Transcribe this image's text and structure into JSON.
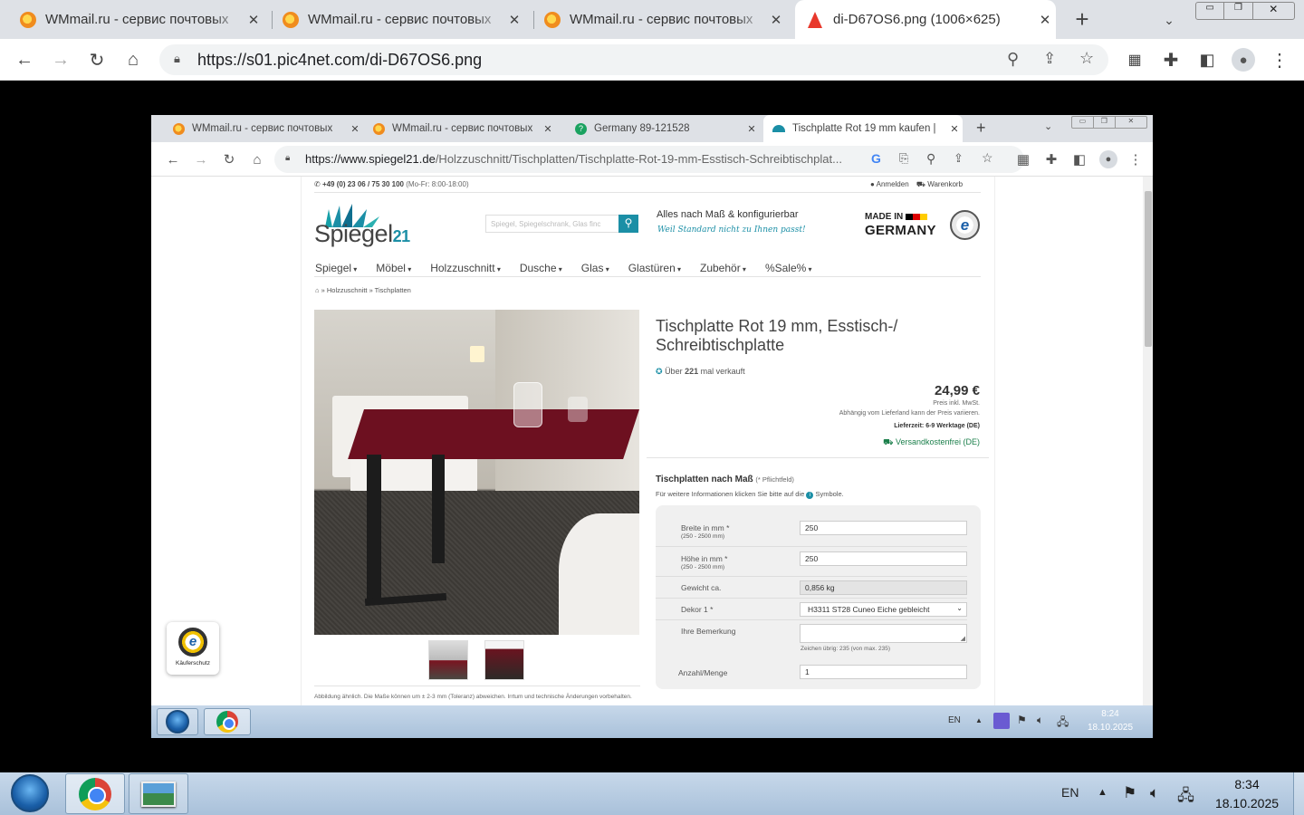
{
  "outer_browser": {
    "tabs": [
      {
        "title": "WMmail.ru - сервис почтовых"
      },
      {
        "title": "WMmail.ru - сервис почтовых"
      },
      {
        "title": "WMmail.ru - сервис почтовых"
      },
      {
        "title": "di-D67OS6.png (1006×625)"
      }
    ],
    "url": "https://s01.pic4net.com/di-D67OS6.png",
    "new_tab_label": "+"
  },
  "inner_browser": {
    "tabs": [
      {
        "title": "WMmail.ru - сервис почтовых"
      },
      {
        "title": "WMmail.ru - сервис почтовых"
      },
      {
        "title": "Germany 89-121528"
      },
      {
        "title": "Tischplatte Rot 19 mm kaufen |"
      }
    ],
    "url_host": "https://www.spiegel21.de",
    "url_path": "/Holzzuschnitt/Tischplatten/Tischplatte-Rot-19-mm-Esstisch-Schreibtischplat..."
  },
  "site": {
    "phone": "+49 (0) 23 06 / 75 30 100",
    "hours": "(Mo-Fr: 8:00-18:00)",
    "login": "Anmelden",
    "cart": "Warenkorb",
    "logo_text": "Spiegel",
    "logo_num": "21",
    "search_placeholder": "Spiegel, Spiegelschrank, Glas finc",
    "tagline": "Alles nach Maß & konfigurierbar",
    "slogan": "Weil Standard nicht zu Ihnen passt!",
    "made_in": "MADE IN",
    "germany": "GERMANY",
    "menu": [
      "Spiegel",
      "Möbel",
      "Holzzuschnitt",
      "Dusche",
      "Glas",
      "Glastüren",
      "Zubehör",
      "%Sale%"
    ],
    "breadcrumb": "» Holzzuschnitt » Tischplatten",
    "product_title": "Tischplatte Rot 19 mm, Esstisch-/ Schreibtischplatte",
    "sold_prefix": "Über",
    "sold_count": "221",
    "sold_suffix": "mal verkauft",
    "price": "24,99 €",
    "price_note": "Preis inkl. MwSt.",
    "price_note2": "Abhängig vom Lieferland kann der Preis variieren.",
    "delivery": "Lieferzeit: 6-9 Werktage (DE)",
    "shipping": "Versandkostenfrei (DE)",
    "config_title": "Tischplatten nach Maß",
    "config_required": "(* Pflichtfeld)",
    "config_info": "Für weitere Informationen klicken Sie bitte auf die",
    "config_info2": "Symbole.",
    "fields": {
      "width_label": "Breite in mm *",
      "width_range": "(250 - 2500 mm)",
      "width_value": "250",
      "height_label": "Höhe in mm *",
      "height_range": "(250 - 2500 mm)",
      "height_value": "250",
      "weight_label": "Gewicht ca.",
      "weight_value": "0,856 kg",
      "decor_label": "Dekor 1 *",
      "decor_value": "H3311 ST28 Cuneo Eiche gebleicht",
      "note_label": "Ihre Bemerkung",
      "chars_left": "Zeichen übrig: 235 (von max. 235)",
      "qty_label": "Anzahl/Menge",
      "qty_value": "1"
    },
    "disclaimer": "Abbildung ähnlich. Die Maße können um ± 2-3 mm (Toleranz) abweichen. Irrtum und technische Änderungen vorbehalten.",
    "trust_label": "Käuferschutz"
  },
  "inner_taskbar": {
    "lang": "EN",
    "time": "8:24",
    "date": "18.10.2025"
  },
  "outer_taskbar": {
    "lang": "EN",
    "time": "8:34",
    "date": "18.10.2025"
  },
  "colors": {
    "accent": "#1b8fa6",
    "tabbar": "#dee1e6",
    "taskbar": "#b9cde3",
    "red_table": "#7a1420"
  }
}
